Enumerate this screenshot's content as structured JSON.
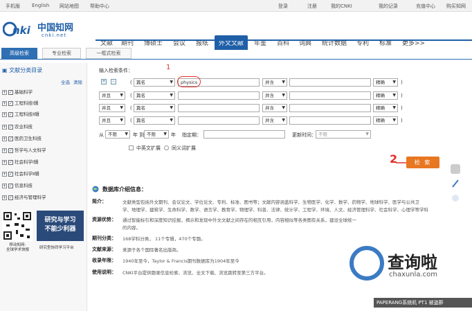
{
  "topbar": {
    "items": [
      "手机版",
      "English",
      "网站地图",
      "帮助中心"
    ],
    "login": "登录",
    "register": "注册",
    "mycnki": "我的CNKI",
    "records": "我的记录",
    "recharge": "充值中心",
    "buy": "购买知网"
  },
  "logo": {
    "cn": "中国知网",
    "url": "cnki.net"
  },
  "nav": [
    "文献",
    "期刊",
    "博硕士",
    "会议",
    "报纸",
    "外文文献",
    "年鉴",
    "百科",
    "词典",
    "统计数据",
    "专利",
    "标准",
    "更多>>"
  ],
  "tabs": [
    "高级检索",
    "专业检索",
    "一框式检索"
  ],
  "left": {
    "title": "文献分类目录",
    "select_all": "全选",
    "clear": "清除",
    "categories": [
      "基础科学",
      "工程科技Ⅰ辑",
      "工程科技Ⅱ辑",
      "农业科技",
      "医药卫生科技",
      "哲学与人文科学",
      "社会科学Ⅰ辑",
      "社会科学Ⅱ辑",
      "信息科技",
      "经济与管理科学"
    ]
  },
  "form": {
    "title": "输入检索条件：",
    "rows": [
      {
        "logic": "",
        "field": "篇名",
        "value": "physics",
        "op": "并含",
        "match": "精确"
      },
      {
        "logic": "并且",
        "field": "篇名",
        "value": "",
        "op": "并含",
        "match": "精确"
      },
      {
        "logic": "并且",
        "field": "篇名",
        "value": "",
        "op": "并含",
        "match": "精确"
      },
      {
        "logic": "并且",
        "field": "篇名",
        "value": "",
        "op": "并含",
        "match": "精确"
      }
    ],
    "from_label": "从",
    "from_val": "不限",
    "year_to": "年 到",
    "to_val": "不限",
    "year": "年",
    "period_label": "指定期：",
    "update_label": "更新时间：",
    "update_val": "不限",
    "cn_ext": "中英文扩展",
    "synonym_ext": "同义词扩展",
    "search_btn": "检 索",
    "annot1": "1",
    "annot2": "2"
  },
  "info": {
    "title": "数据库介绍信息：",
    "rows": [
      {
        "h": "简介：",
        "t": "文献类型包括外文期刊、会议论文、学位论文、专利、标准、图书等；文献内容涵盖科学、生物医学、化学、数学、药物学、地球科学、医学与公共卫"
      },
      {
        "h": "",
        "t": "学、地理学、建筑学、生命科学、数学、语言学、教育学、物理学、科普、法律、统计学、工程学、环境、人文、经济管理科学、社会科学、心理学等学科"
      },
      {
        "h": "资源优势：",
        "t": "通过智能标引和深度知识挖掘，揭示和发现中外文文献之间存在的相互引用，内容相似等各类图有关系，建设全球统一"
      },
      {
        "h": "",
        "t": "的内容。"
      },
      {
        "h": "期刊分类：",
        "t": "168学科分类， 11个专辑，470个专题。"
      },
      {
        "h": "文献来源：",
        "t": "来源于各个国际著名出版商。"
      },
      {
        "h": "收录年限：",
        "t": "1940年至今，Taylor & Francis期刊数据库为1904年至今"
      },
      {
        "h": "使用说明：",
        "t": "CNKI平台提供题录信息检索、浏览、全文下载、浏览跳转至第三方平台。"
      }
    ]
  },
  "ad": {
    "line1": "研究与学习",
    "line2": "不能少利器",
    "caption1": "移动知网-",
    "caption2": "全球学术快报",
    "caption3": "研究型协同学习平台"
  },
  "watermark": {
    "brand": "查询啦",
    "site": "chaxunla.com",
    "banner": "PAPERANG系统机 PT1 被盗群"
  }
}
